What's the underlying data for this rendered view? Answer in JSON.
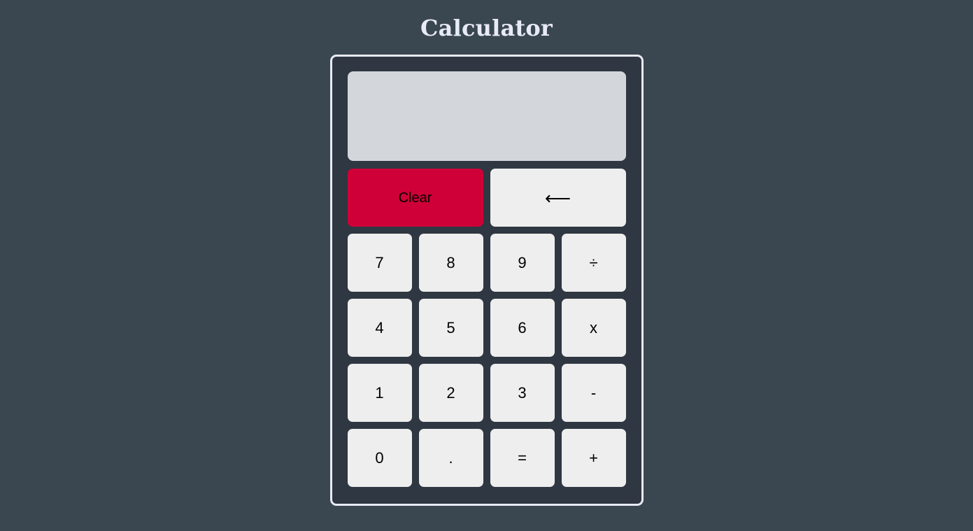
{
  "page": {
    "title": "Calculator",
    "background_color": "#3a4750",
    "title_color": "#e8eaf6"
  },
  "calculator": {
    "body_color": "#2f3742",
    "border_color": "#e8eaf6",
    "display": {
      "value": "",
      "background_color": "#d3d7dc"
    },
    "colors": {
      "key_background": "#eeeeee",
      "key_text": "#000000",
      "clear_background": "#ce0037"
    },
    "keys": {
      "clear": "Clear",
      "backspace": "⟵",
      "seven": "7",
      "eight": "8",
      "nine": "9",
      "divide": "÷",
      "four": "4",
      "five": "5",
      "six": "6",
      "multiply": "x",
      "one": "1",
      "two": "2",
      "three": "3",
      "minus": "-",
      "zero": "0",
      "decimal": ".",
      "equals": "=",
      "plus": "+"
    }
  }
}
